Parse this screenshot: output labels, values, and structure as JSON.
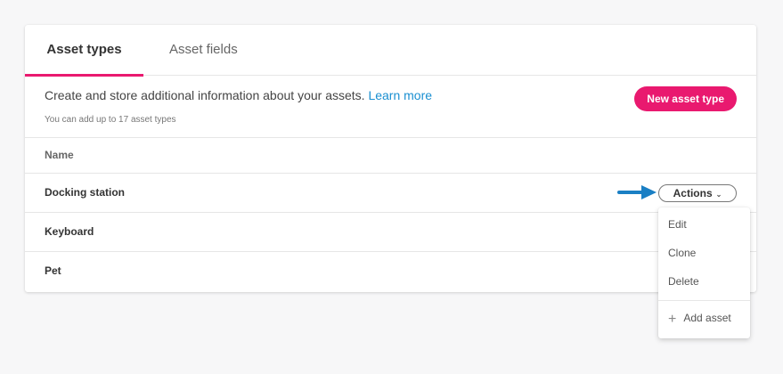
{
  "tabs": [
    {
      "label": "Asset types",
      "active": true
    },
    {
      "label": "Asset fields",
      "active": false
    }
  ],
  "intro": {
    "text": "Create and store additional information about your assets.",
    "link": "Learn more",
    "subtext": "You can add up to 17 asset types"
  },
  "new_button": "New asset type",
  "table": {
    "header": "Name",
    "rows": [
      "Docking station",
      "Keyboard",
      "Pet"
    ]
  },
  "actions_button": "Actions",
  "actions_menu": {
    "items": [
      "Edit",
      "Clone",
      "Delete"
    ],
    "add": "Add asset"
  },
  "colors": {
    "accent": "#e9196f",
    "link": "#1a8fd1",
    "arrow": "#1a7fc4"
  },
  "icons": {
    "chevron": "chevron-down-icon",
    "arrow": "arrow-right-icon",
    "plus": "plus-icon"
  }
}
